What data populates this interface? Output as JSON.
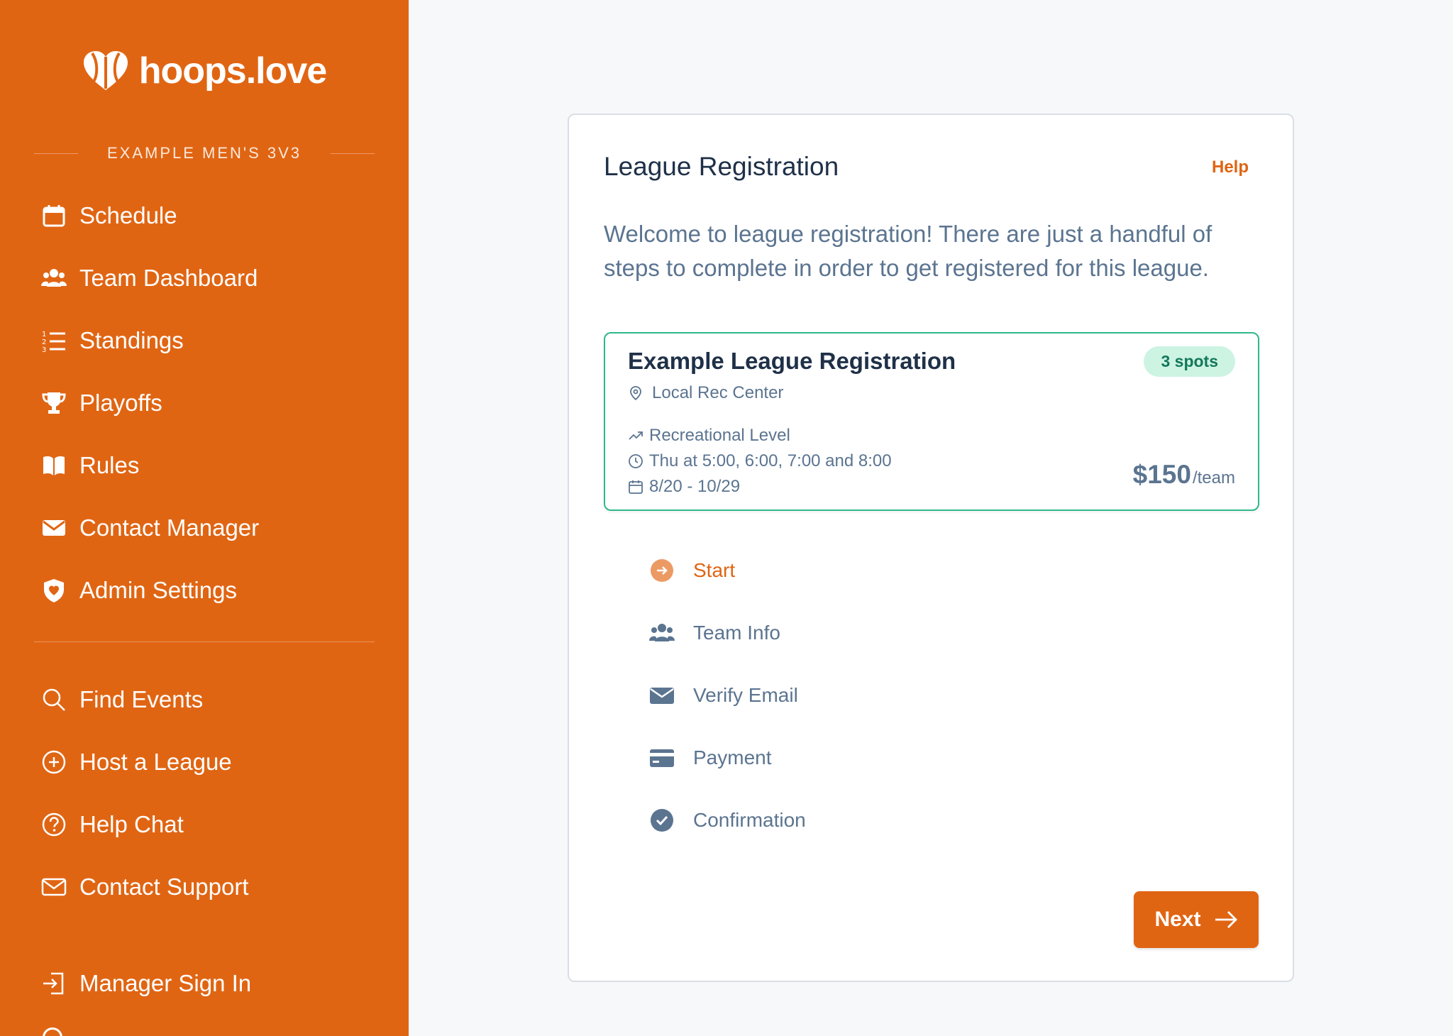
{
  "brand": {
    "name": "hoops.love"
  },
  "sidebar": {
    "league_name": "EXAMPLE MEN'S 3V3",
    "items": [
      {
        "label": "Schedule",
        "icon": "calendar-icon"
      },
      {
        "label": "Team Dashboard",
        "icon": "users-icon"
      },
      {
        "label": "Standings",
        "icon": "list-ordered-icon"
      },
      {
        "label": "Playoffs",
        "icon": "trophy-icon"
      },
      {
        "label": "Rules",
        "icon": "book-icon"
      },
      {
        "label": "Contact Manager",
        "icon": "envelope-icon"
      },
      {
        "label": "Admin Settings",
        "icon": "shield-heart-icon"
      }
    ],
    "secondary_items": [
      {
        "label": "Find Events",
        "icon": "search-icon"
      },
      {
        "label": "Host a League",
        "icon": "plus-circle-icon"
      },
      {
        "label": "Help Chat",
        "icon": "question-circle-icon"
      },
      {
        "label": "Contact Support",
        "icon": "mail-outline-icon"
      },
      {
        "label": "Manager Sign In",
        "icon": "sign-in-icon"
      }
    ]
  },
  "card": {
    "title": "League Registration",
    "help_label": "Help",
    "intro": "Welcome to league registration! There are just a handful of steps to complete in order to get registered for this league.",
    "league": {
      "name": "Example League Registration",
      "spots": "3 spots",
      "location": "Local Rec Center",
      "level": "Recreational Level",
      "time": "Thu at 5:00, 6:00, 7:00 and 8:00",
      "dates": "8/20 - 10/29",
      "price": "$150",
      "price_unit": "/team"
    },
    "steps": [
      {
        "label": "Start",
        "icon": "arrow-circle-icon",
        "active": true
      },
      {
        "label": "Team Info",
        "icon": "users-icon",
        "active": false
      },
      {
        "label": "Verify Email",
        "icon": "envelope-icon",
        "active": false
      },
      {
        "label": "Payment",
        "icon": "credit-card-icon",
        "active": false
      },
      {
        "label": "Confirmation",
        "icon": "check-circle-icon",
        "active": false
      }
    ],
    "next_label": "Next"
  },
  "colors": {
    "brand_orange": "#e06513",
    "sidebar_bg": "#e06513",
    "text_dark": "#1f3048",
    "text_muted": "#5b7490",
    "success_green": "#2fb98a",
    "badge_bg": "#cdf3e3"
  }
}
